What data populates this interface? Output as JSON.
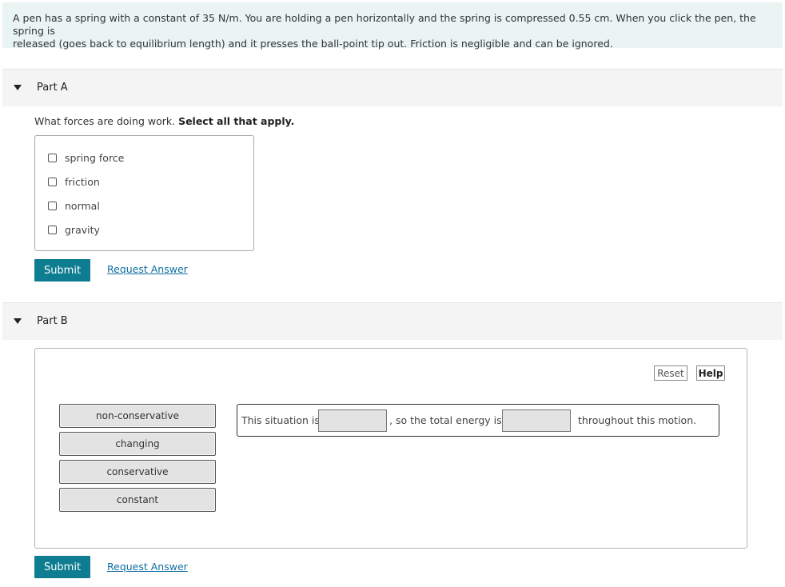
{
  "problem": {
    "line1": "A pen has a spring with a constant of 35 N/m. You are holding a pen horizontally and the spring is compressed 0.55 cm. When you click the pen, the spring is",
    "line2": "released (goes back to equilibrium length) and it presses the ball-point tip out. Friction is negligible and can be ignored."
  },
  "partA": {
    "label": "Part A",
    "question": "What forces are doing work.",
    "instruction": "Select all that apply.",
    "options": [
      "spring force",
      "friction",
      "normal",
      "gravity"
    ],
    "submit_label": "Submit",
    "request_answer_label": "Request Answer"
  },
  "partB": {
    "label": "Part B",
    "reset_label": "Reset",
    "help_label": "Help",
    "tiles": [
      "non-conservative",
      "changing",
      "conservative",
      "constant"
    ],
    "sentence": {
      "part1": "This situation is",
      "part2": ", so the total energy is",
      "part3": "throughout this motion."
    },
    "submit_label": "Submit",
    "request_answer_label": "Request Answer"
  },
  "colors": {
    "accent": "#0e7c91",
    "problem_bg": "#e9f4f3",
    "link": "#0e6fa0"
  }
}
